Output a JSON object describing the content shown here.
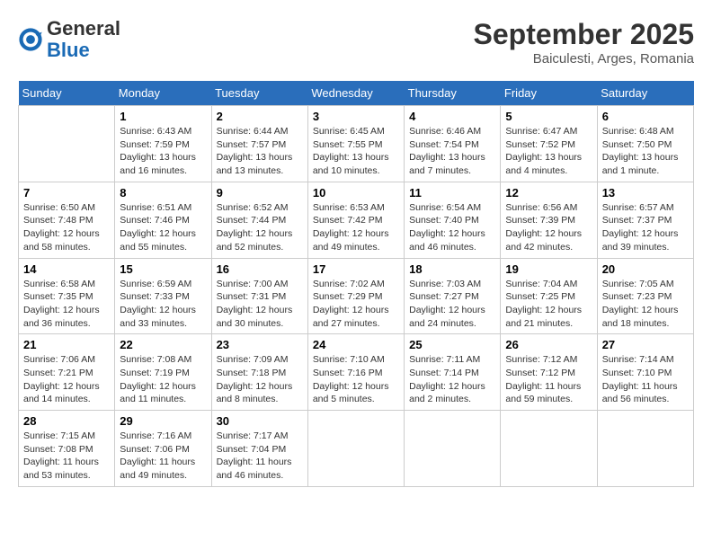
{
  "header": {
    "logo_general": "General",
    "logo_blue": "Blue",
    "month_title": "September 2025",
    "location": "Baiculesti, Arges, Romania"
  },
  "days_of_week": [
    "Sunday",
    "Monday",
    "Tuesday",
    "Wednesday",
    "Thursday",
    "Friday",
    "Saturday"
  ],
  "weeks": [
    [
      {
        "day": "",
        "info": ""
      },
      {
        "day": "1",
        "info": "Sunrise: 6:43 AM\nSunset: 7:59 PM\nDaylight: 13 hours\nand 16 minutes."
      },
      {
        "day": "2",
        "info": "Sunrise: 6:44 AM\nSunset: 7:57 PM\nDaylight: 13 hours\nand 13 minutes."
      },
      {
        "day": "3",
        "info": "Sunrise: 6:45 AM\nSunset: 7:55 PM\nDaylight: 13 hours\nand 10 minutes."
      },
      {
        "day": "4",
        "info": "Sunrise: 6:46 AM\nSunset: 7:54 PM\nDaylight: 13 hours\nand 7 minutes."
      },
      {
        "day": "5",
        "info": "Sunrise: 6:47 AM\nSunset: 7:52 PM\nDaylight: 13 hours\nand 4 minutes."
      },
      {
        "day": "6",
        "info": "Sunrise: 6:48 AM\nSunset: 7:50 PM\nDaylight: 13 hours\nand 1 minute."
      }
    ],
    [
      {
        "day": "7",
        "info": "Sunrise: 6:50 AM\nSunset: 7:48 PM\nDaylight: 12 hours\nand 58 minutes."
      },
      {
        "day": "8",
        "info": "Sunrise: 6:51 AM\nSunset: 7:46 PM\nDaylight: 12 hours\nand 55 minutes."
      },
      {
        "day": "9",
        "info": "Sunrise: 6:52 AM\nSunset: 7:44 PM\nDaylight: 12 hours\nand 52 minutes."
      },
      {
        "day": "10",
        "info": "Sunrise: 6:53 AM\nSunset: 7:42 PM\nDaylight: 12 hours\nand 49 minutes."
      },
      {
        "day": "11",
        "info": "Sunrise: 6:54 AM\nSunset: 7:40 PM\nDaylight: 12 hours\nand 46 minutes."
      },
      {
        "day": "12",
        "info": "Sunrise: 6:56 AM\nSunset: 7:39 PM\nDaylight: 12 hours\nand 42 minutes."
      },
      {
        "day": "13",
        "info": "Sunrise: 6:57 AM\nSunset: 7:37 PM\nDaylight: 12 hours\nand 39 minutes."
      }
    ],
    [
      {
        "day": "14",
        "info": "Sunrise: 6:58 AM\nSunset: 7:35 PM\nDaylight: 12 hours\nand 36 minutes."
      },
      {
        "day": "15",
        "info": "Sunrise: 6:59 AM\nSunset: 7:33 PM\nDaylight: 12 hours\nand 33 minutes."
      },
      {
        "day": "16",
        "info": "Sunrise: 7:00 AM\nSunset: 7:31 PM\nDaylight: 12 hours\nand 30 minutes."
      },
      {
        "day": "17",
        "info": "Sunrise: 7:02 AM\nSunset: 7:29 PM\nDaylight: 12 hours\nand 27 minutes."
      },
      {
        "day": "18",
        "info": "Sunrise: 7:03 AM\nSunset: 7:27 PM\nDaylight: 12 hours\nand 24 minutes."
      },
      {
        "day": "19",
        "info": "Sunrise: 7:04 AM\nSunset: 7:25 PM\nDaylight: 12 hours\nand 21 minutes."
      },
      {
        "day": "20",
        "info": "Sunrise: 7:05 AM\nSunset: 7:23 PM\nDaylight: 12 hours\nand 18 minutes."
      }
    ],
    [
      {
        "day": "21",
        "info": "Sunrise: 7:06 AM\nSunset: 7:21 PM\nDaylight: 12 hours\nand 14 minutes."
      },
      {
        "day": "22",
        "info": "Sunrise: 7:08 AM\nSunset: 7:19 PM\nDaylight: 12 hours\nand 11 minutes."
      },
      {
        "day": "23",
        "info": "Sunrise: 7:09 AM\nSunset: 7:18 PM\nDaylight: 12 hours\nand 8 minutes."
      },
      {
        "day": "24",
        "info": "Sunrise: 7:10 AM\nSunset: 7:16 PM\nDaylight: 12 hours\nand 5 minutes."
      },
      {
        "day": "25",
        "info": "Sunrise: 7:11 AM\nSunset: 7:14 PM\nDaylight: 12 hours\nand 2 minutes."
      },
      {
        "day": "26",
        "info": "Sunrise: 7:12 AM\nSunset: 7:12 PM\nDaylight: 11 hours\nand 59 minutes."
      },
      {
        "day": "27",
        "info": "Sunrise: 7:14 AM\nSunset: 7:10 PM\nDaylight: 11 hours\nand 56 minutes."
      }
    ],
    [
      {
        "day": "28",
        "info": "Sunrise: 7:15 AM\nSunset: 7:08 PM\nDaylight: 11 hours\nand 53 minutes."
      },
      {
        "day": "29",
        "info": "Sunrise: 7:16 AM\nSunset: 7:06 PM\nDaylight: 11 hours\nand 49 minutes."
      },
      {
        "day": "30",
        "info": "Sunrise: 7:17 AM\nSunset: 7:04 PM\nDaylight: 11 hours\nand 46 minutes."
      },
      {
        "day": "",
        "info": ""
      },
      {
        "day": "",
        "info": ""
      },
      {
        "day": "",
        "info": ""
      },
      {
        "day": "",
        "info": ""
      }
    ]
  ]
}
